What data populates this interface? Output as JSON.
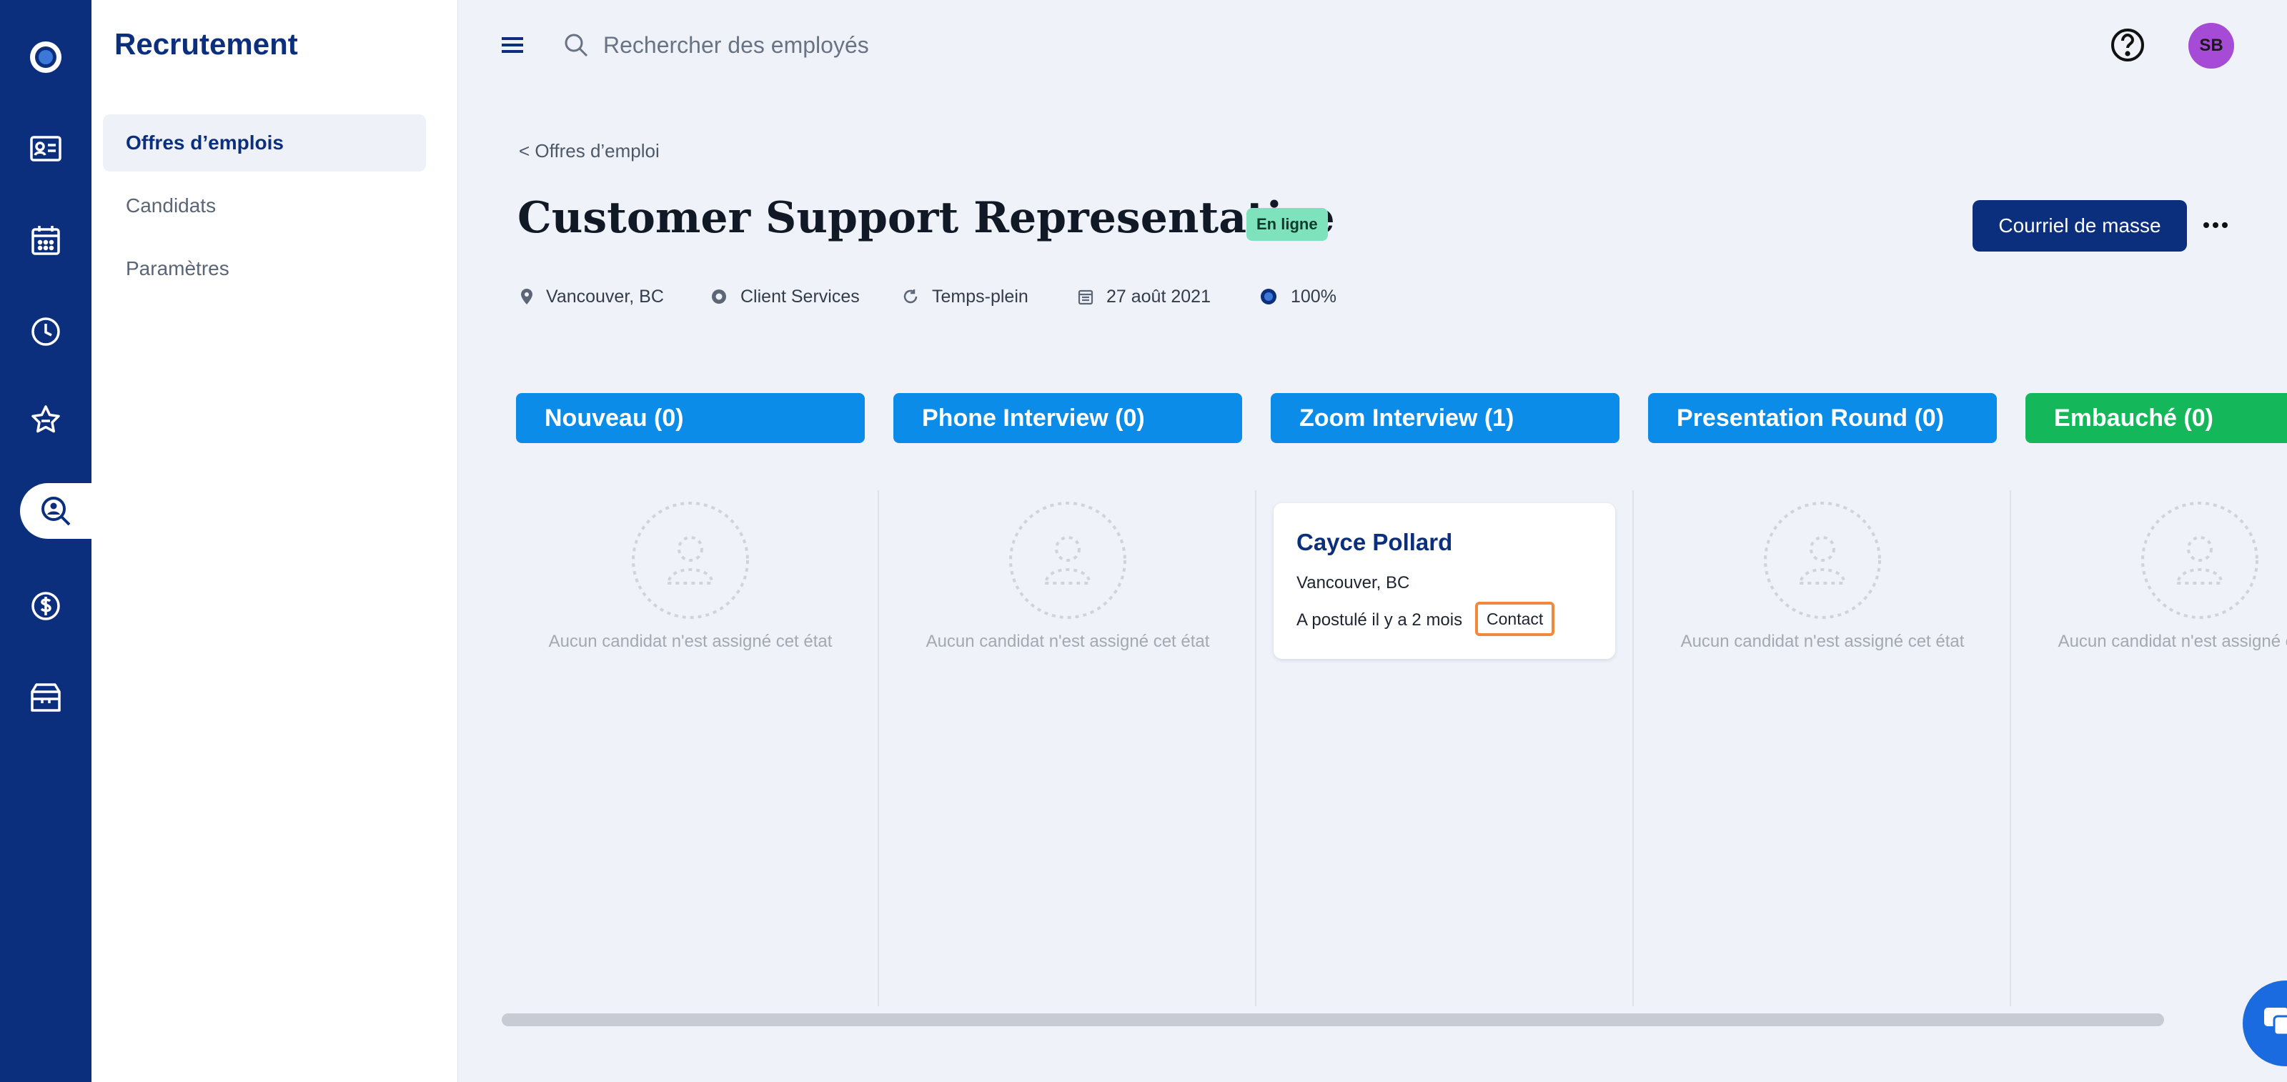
{
  "sidebar": {
    "icons": [
      "logo-icon",
      "contact-card-icon",
      "calendar-icon",
      "clock-icon",
      "star-badge-icon",
      "recruiting-search-icon",
      "dollar-icon",
      "box-icon"
    ]
  },
  "subnav": {
    "title": "Recrutement",
    "items": [
      {
        "label": "Offres d’emplois",
        "active": true
      },
      {
        "label": "Candidats",
        "active": false
      },
      {
        "label": "Paramètres",
        "active": false
      }
    ]
  },
  "header": {
    "search_placeholder": "Rechercher des employés",
    "avatar_initials": "SB"
  },
  "job": {
    "breadcrumb": "< Offres d’emploi",
    "title": "Customer Support Representative",
    "status": "En ligne",
    "bulk_email_label": "Courriel de masse",
    "location": "Vancouver, BC",
    "department": "Client Services",
    "employment_type": "Temps-plein",
    "date": "27 août 2021",
    "completion": "100%"
  },
  "board": {
    "columns": [
      {
        "label": "Nouveau (0)",
        "color": "#0b8ce9"
      },
      {
        "label": "Phone Interview (0)",
        "color": "#0b8ce9"
      },
      {
        "label": "Zoom Interview (1)",
        "color": "#0b8ce9"
      },
      {
        "label": "Presentation Round (0)",
        "color": "#0b8ce9"
      },
      {
        "label": "Embauché (0)",
        "color": "#14b85a"
      }
    ],
    "empty_text": "Aucun candidat n'est assigné cet état",
    "card": {
      "name": "Cayce Pollard",
      "location": "Vancouver, BC",
      "applied": "A postulé il y a 2 mois",
      "contact_label": "Contact"
    }
  }
}
